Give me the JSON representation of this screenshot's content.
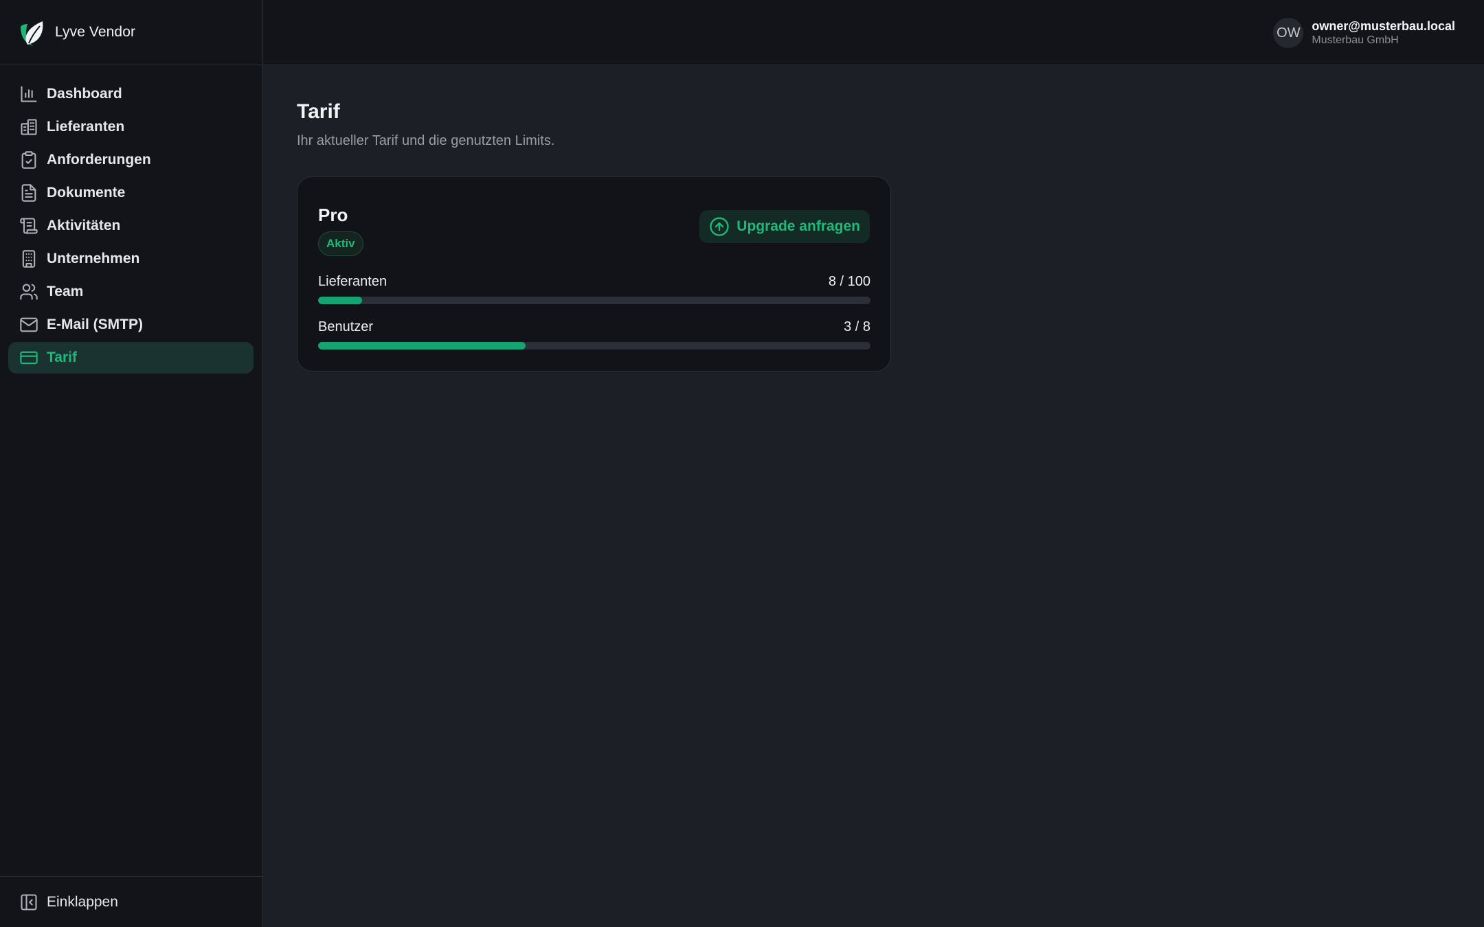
{
  "brand": {
    "name": "Lyve Vendor"
  },
  "sidebar": {
    "items": [
      {
        "label": "Dashboard",
        "icon": "bar-chart-icon"
      },
      {
        "label": "Lieferanten",
        "icon": "building-icon"
      },
      {
        "label": "Anforderungen",
        "icon": "clipboard-check-icon"
      },
      {
        "label": "Dokumente",
        "icon": "document-icon"
      },
      {
        "label": "Aktivitäten",
        "icon": "scroll-icon"
      },
      {
        "label": "Unternehmen",
        "icon": "office-building-icon"
      },
      {
        "label": "Team",
        "icon": "users-icon"
      },
      {
        "label": "E-Mail (SMTP)",
        "icon": "mail-icon"
      },
      {
        "label": "Tarif",
        "icon": "credit-card-icon",
        "active": true
      }
    ],
    "collapse_label": "Einklappen"
  },
  "user": {
    "initials": "OW",
    "email": "owner@musterbau.local",
    "company": "Musterbau GmbH"
  },
  "page": {
    "title": "Tarif",
    "subtitle": "Ihr aktueller Tarif und die genutzten Limits."
  },
  "plan": {
    "name": "Pro",
    "status": "Aktiv",
    "upgrade_label": "Upgrade anfragen",
    "limits": [
      {
        "label": "Lieferanten",
        "used": 8,
        "max": 100,
        "display": "8 / 100"
      },
      {
        "label": "Benutzer",
        "used": 3,
        "max": 8,
        "display": "3 / 8"
      }
    ]
  },
  "colors": {
    "accent": "#1fb97a",
    "background": "#1d1f27",
    "sidebar": "#131419"
  }
}
